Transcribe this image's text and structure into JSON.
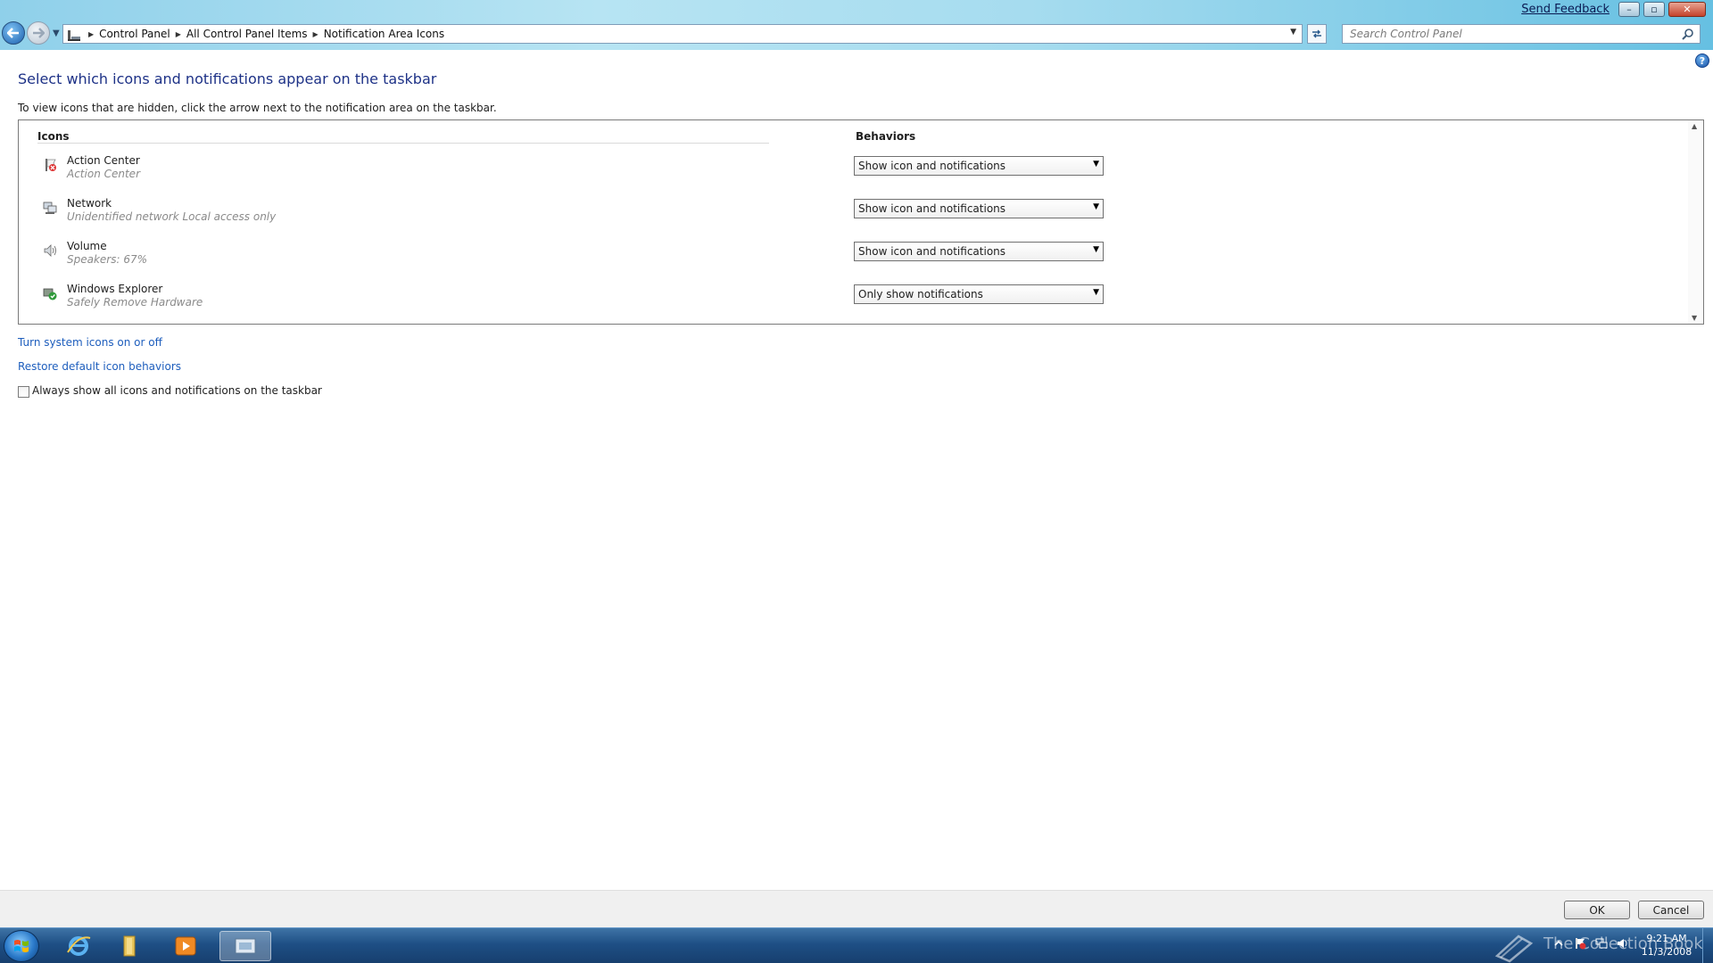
{
  "window": {
    "send_feedback": "Send Feedback",
    "caption_min": "–",
    "caption_max": "▫",
    "caption_close": "✕"
  },
  "address": {
    "breadcrumbs": [
      "Control Panel",
      "All Control Panel Items",
      "Notification Area Icons"
    ],
    "search_placeholder": "Search Control Panel"
  },
  "main": {
    "title": "Select which icons and notifications appear on the taskbar",
    "instruction": "To view icons that are hidden, click the arrow next to the notification area on the taskbar.",
    "columns": {
      "icons": "Icons",
      "behaviors": "Behaviors"
    },
    "rows": [
      {
        "name": "Action Center",
        "sub": "Action Center",
        "icon": "action-center-flag-icon",
        "behavior": "Show icon and notifications"
      },
      {
        "name": "Network",
        "sub": "Unidentified network Local access only",
        "icon": "network-icon",
        "behavior": "Show icon and notifications"
      },
      {
        "name": "Volume",
        "sub": "Speakers: 67%",
        "icon": "speaker-icon",
        "behavior": "Show icon and notifications"
      },
      {
        "name": "Windows Explorer",
        "sub": "Safely Remove Hardware",
        "icon": "safely-remove-hardware-icon",
        "behavior": "Only show notifications"
      }
    ],
    "links": {
      "system_icons": "Turn system icons on or off",
      "restore_defaults": "Restore default icon behaviors"
    },
    "always_show_label": "Always show all icons and notifications on the taskbar",
    "always_show_checked": false
  },
  "buttons": {
    "ok": "OK",
    "cancel": "Cancel"
  },
  "taskbar": {
    "watermark": "The Collection Book",
    "time": "9:21 AM",
    "date": "11/3/2008"
  },
  "colors": {
    "title_blue": "#1e3287",
    "link_blue": "#1e5ebd",
    "taskbar": "#1e4f85"
  }
}
